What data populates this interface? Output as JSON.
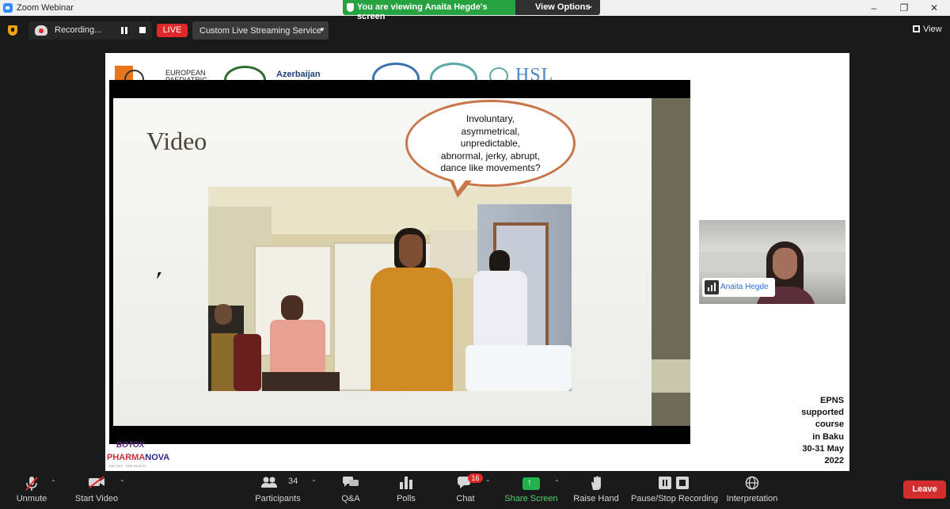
{
  "window": {
    "title": "Zoom Webinar",
    "sharing_banner": "You are viewing Anaita Hegde's screen",
    "view_options": "View Options"
  },
  "top_toolbar": {
    "recording_label": "Recording...",
    "live_label": "LIVE",
    "stream_service": "Custom Live Streaming Service",
    "view_label": "View"
  },
  "slide": {
    "title": "Video",
    "bubble_lines": [
      "Involuntary,",
      "asymmetrical,",
      "unpredictable,",
      "abnormal, jerky, abrupt,",
      "dance like movements?"
    ]
  },
  "shared_screen": {
    "logo_ep_lines": [
      "EUROPEAN",
      "PAEDIATRIC"
    ],
    "logo_az": "Azerbaijan",
    "logo_hsl": "HSL",
    "sponsors": {
      "botox": "BOTOX",
      "pharma_a": "PHARMA",
      "pharma_b": "NOVA",
      "tagline": "ONE LIFE · ONE HEALTH"
    },
    "course_note": [
      "EPNS",
      "supported",
      "course",
      "in Baku",
      "30-31 May",
      "2022"
    ]
  },
  "participant_tile": {
    "name": "Anaita Hegde"
  },
  "bottom_toolbar": {
    "unmute": "Unmute",
    "start_video": "Start Video",
    "participants": "Participants",
    "participants_count": "34",
    "qa": "Q&A",
    "polls": "Polls",
    "chat": "Chat",
    "chat_badge": "16",
    "share_screen": "Share Screen",
    "raise_hand": "Raise Hand",
    "pause_stop_recording": "Pause/Stop Recording",
    "interpretation": "Interpretation",
    "leave": "Leave"
  },
  "colors": {
    "accent_green": "#26a340",
    "live_red": "#e02828",
    "leave_red": "#d42d2d",
    "name_blue": "#2d6fd6",
    "bubble_border": "#c9774a"
  }
}
